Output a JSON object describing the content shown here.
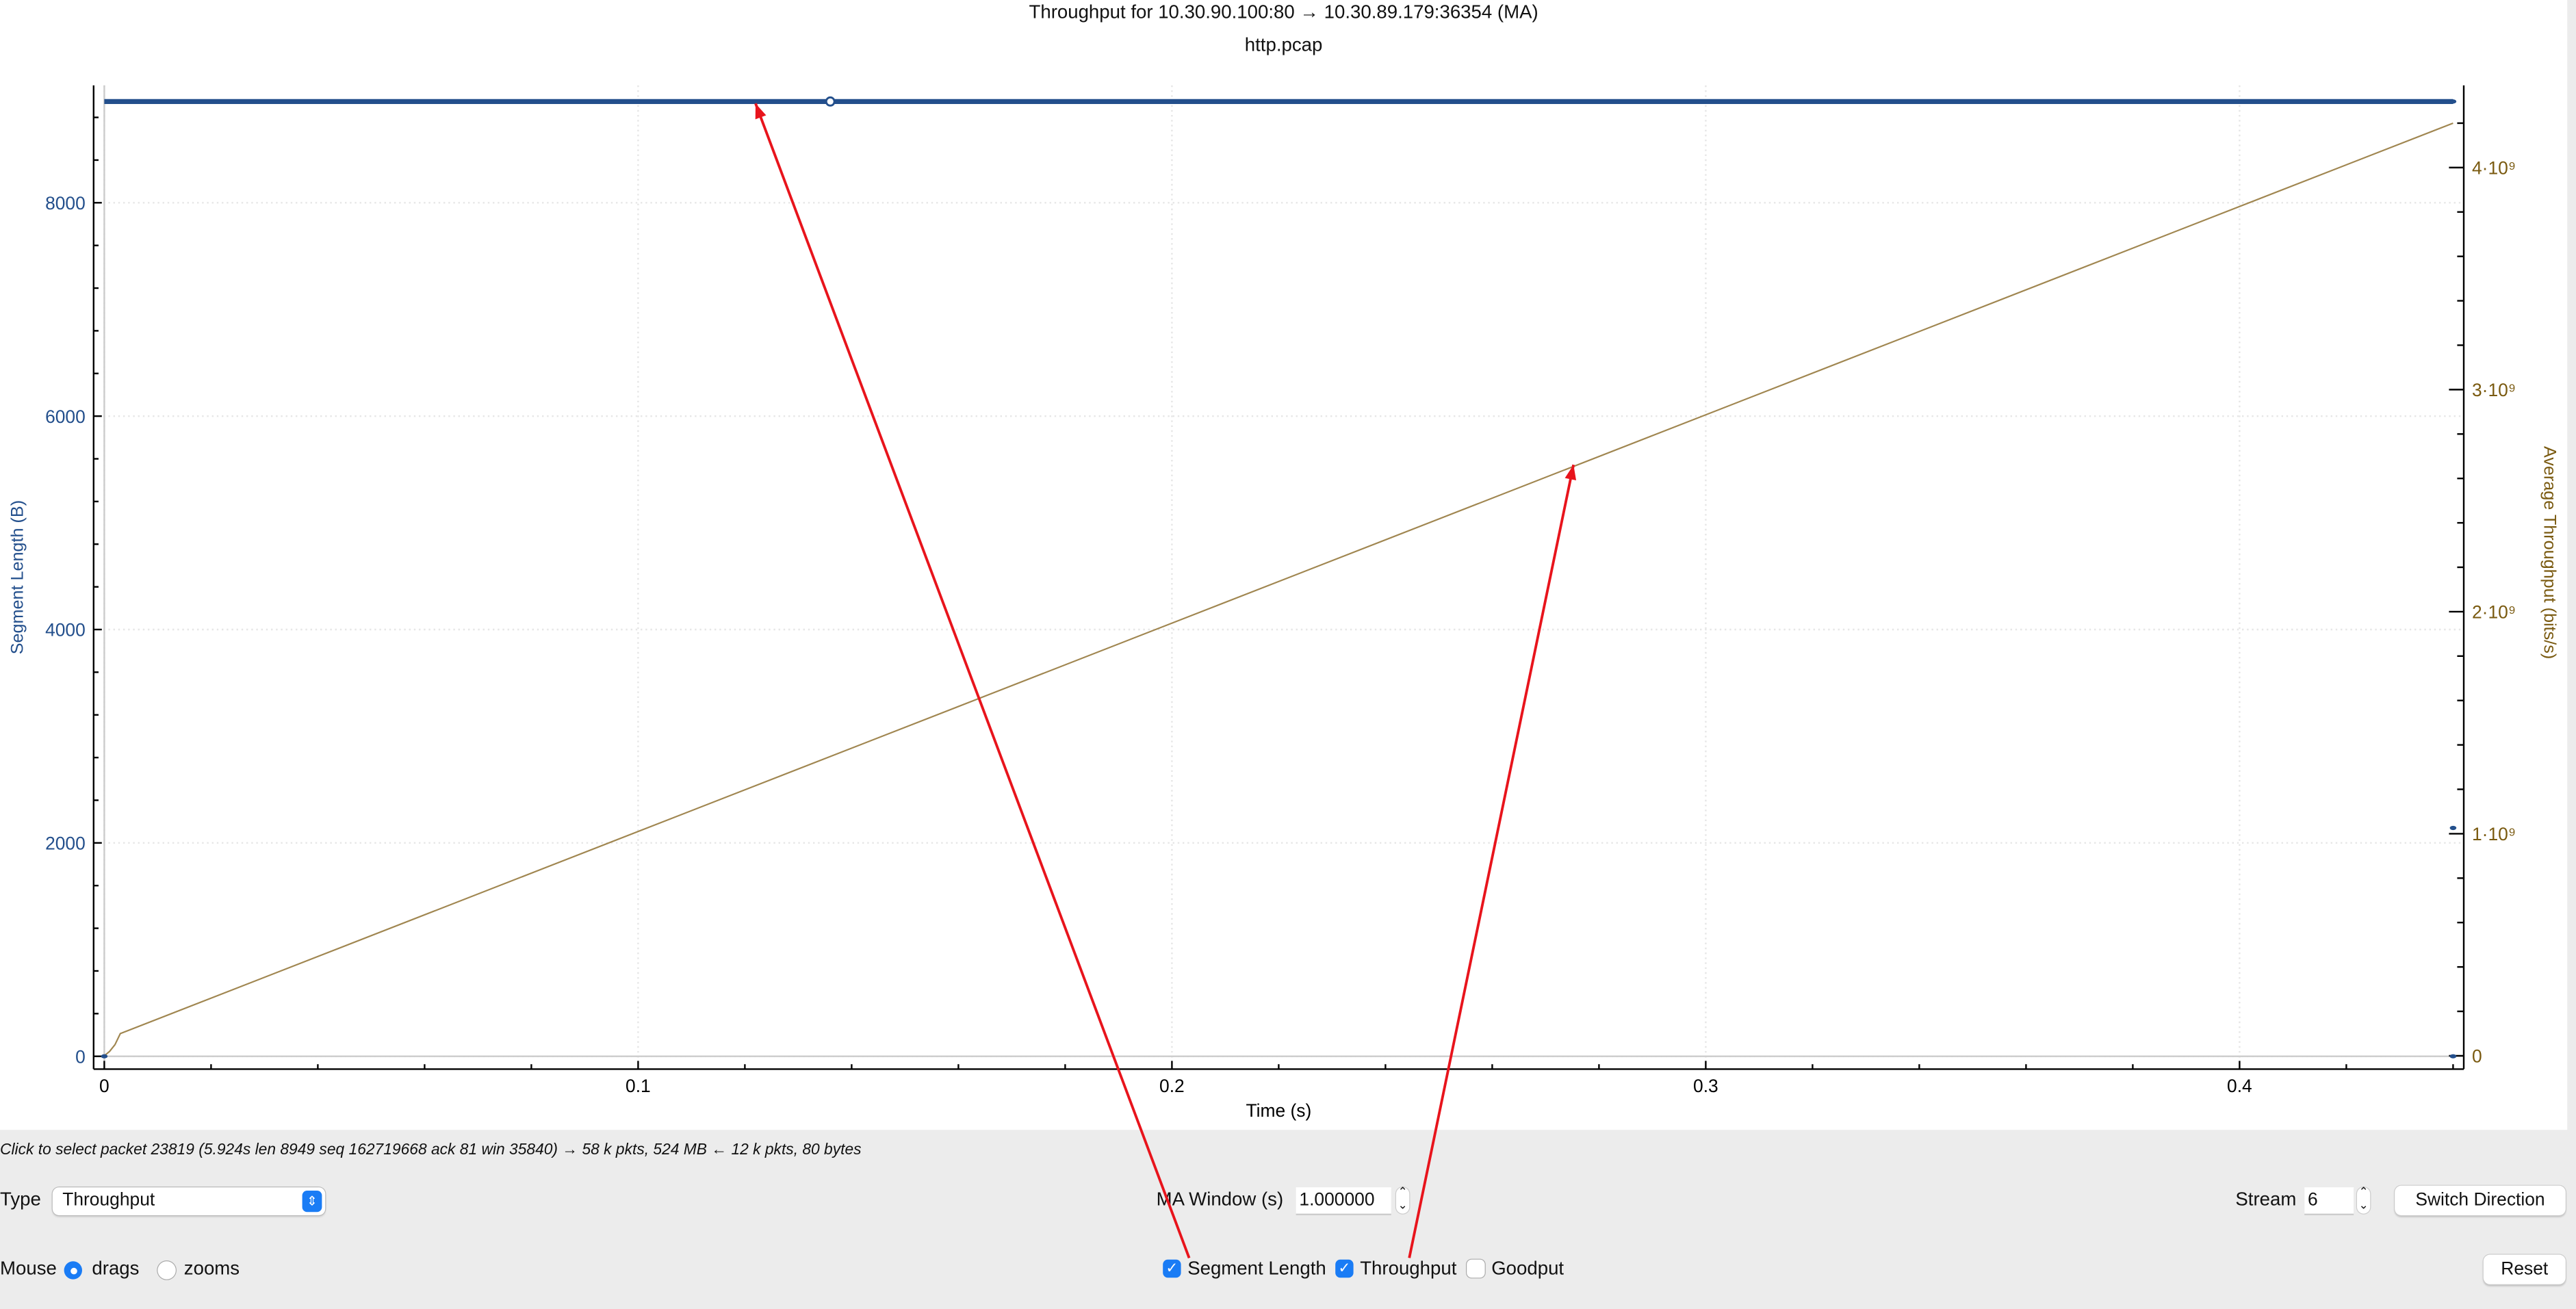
{
  "header": {
    "title": "Throughput for 10.30.90.100:80 → 10.30.89.179:36354 (MA)",
    "subtitle": "http.pcap"
  },
  "chart_data": {
    "type": "line",
    "title": "Throughput for 10.30.90.100:80 → 10.30.89.179:36354 (MA)",
    "subtitle": "http.pcap",
    "xlabel": "Time (s)",
    "ylabel_left": "Segment Length (B)",
    "ylabel_right": "Average Throughput (bits/s)",
    "xlim": [
      -0.002,
      0.442
    ],
    "ylim_left": [
      -120,
      9100
    ],
    "ylim_right": [
      -60000000.0,
      4370000000.0
    ],
    "x_ticks": [
      {
        "v": 0,
        "label": "0"
      },
      {
        "v": 0.1,
        "label": "0.1"
      },
      {
        "v": 0.2,
        "label": "0.2"
      },
      {
        "v": 0.3,
        "label": "0.3"
      },
      {
        "v": 0.4,
        "label": "0.4"
      }
    ],
    "y_left_ticks": [
      {
        "v": 0,
        "label": "0"
      },
      {
        "v": 2000,
        "label": "2000"
      },
      {
        "v": 4000,
        "label": "4000"
      },
      {
        "v": 6000,
        "label": "6000"
      },
      {
        "v": 8000,
        "label": "8000"
      }
    ],
    "y_right_ticks": [
      {
        "v": 0,
        "label": "0"
      },
      {
        "v": 1000000000.0,
        "label": "1·10⁹"
      },
      {
        "v": 2000000000.0,
        "label": "2·10⁹"
      },
      {
        "v": 3000000000.0,
        "label": "3·10⁹"
      },
      {
        "v": 4000000000.0,
        "label": "4·10⁹"
      }
    ],
    "grid": true,
    "colors": {
      "segment": "#234f8c",
      "throughput": "#a08650",
      "right_axis": "#7a5a10",
      "annotation": "#e8141c"
    },
    "series": [
      {
        "name": "Segment Length",
        "axis": "left",
        "segment_line": {
          "x": [
            0,
            0.44
          ],
          "y": [
            8949,
            8949
          ]
        },
        "points": [
          {
            "x": 0,
            "y": 0
          },
          {
            "x": 0.44,
            "y": 0
          },
          {
            "x": 0.44,
            "y": 2140
          },
          {
            "x": 0.44,
            "y": 8949
          }
        ],
        "selected_point": {
          "x": 0.136,
          "y": 8949
        }
      },
      {
        "name": "Throughput",
        "axis": "right",
        "x": [
          0,
          0.001,
          0.002,
          0.003,
          0.44
        ],
        "y": [
          0,
          20000000.0,
          50000000.0,
          100000000.0,
          4200000000.0
        ]
      }
    ]
  },
  "status": "Click to select packet 23819 (5.924s len 8949 seq 162719668 ack 81 win 35840) → 58 k pkts, 524 MB ← 12 k pkts, 80 bytes",
  "controls": {
    "type_label": "Type",
    "type_value": "Throughput",
    "ma_label": "MA Window (s)",
    "ma_value": "1.000000",
    "stream_label": "Stream",
    "stream_value": "6",
    "switch_direction": "Switch Direction",
    "mouse_label": "Mouse",
    "drags": "drags",
    "zooms": "zooms",
    "mouse_mode": "drags",
    "segment_length": "Segment Length",
    "segment_checked": true,
    "throughput": "Throughput",
    "throughput_checked": true,
    "goodput": "Goodput",
    "goodput_checked": false,
    "reset": "Reset"
  }
}
